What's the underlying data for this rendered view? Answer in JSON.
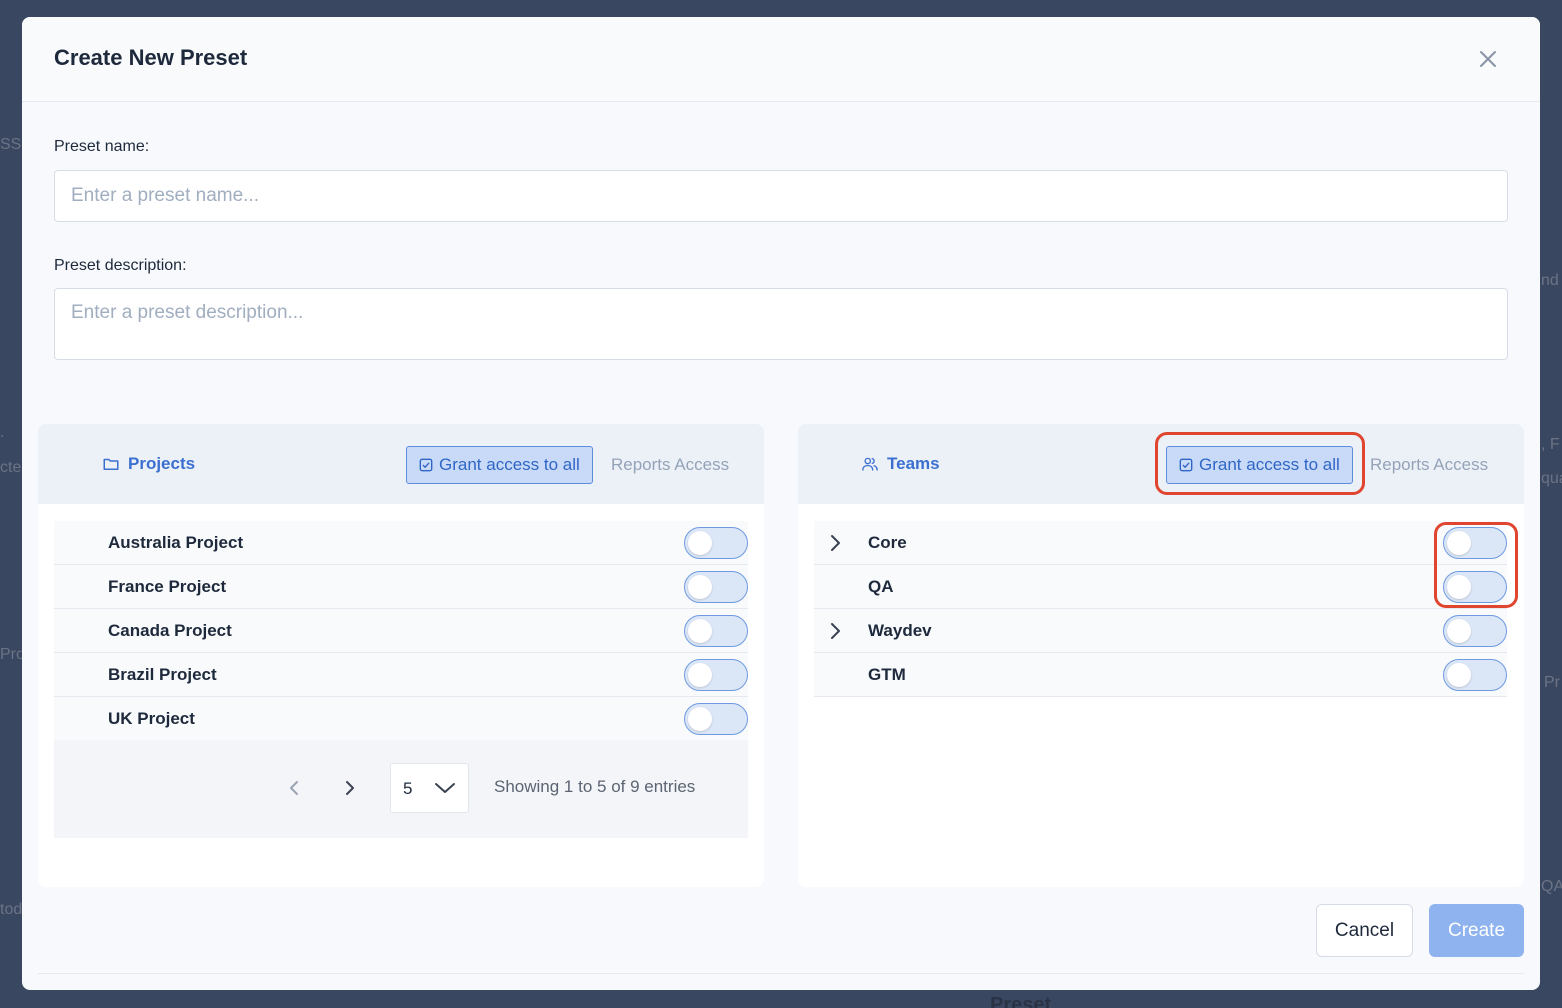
{
  "modal": {
    "title": "Create New Preset",
    "name_label": "Preset name:",
    "name_value": "",
    "name_placeholder": "Enter a preset name...",
    "description_label": "Preset description:",
    "description_value": "",
    "description_placeholder": "Enter a preset description..."
  },
  "projects_panel": {
    "title": "Projects",
    "grant_label": "Grant access to all",
    "reports_label": "Reports Access",
    "rows": [
      {
        "label": "Australia Project",
        "enabled": false
      },
      {
        "label": "France Project",
        "enabled": false
      },
      {
        "label": "Canada Project",
        "enabled": false
      },
      {
        "label": "Brazil Project",
        "enabled": false
      },
      {
        "label": "UK Project",
        "enabled": false
      }
    ],
    "pagination": {
      "page_size": "5",
      "showing_text": "Showing 1 to 5 of 9 entries"
    }
  },
  "teams_panel": {
    "title": "Teams",
    "grant_label": "Grant access to all",
    "reports_label": "Reports Access",
    "rows": [
      {
        "label": "Core",
        "expandable": true,
        "enabled": false
      },
      {
        "label": "QA",
        "expandable": false,
        "enabled": false
      },
      {
        "label": "Waydev",
        "expandable": true,
        "enabled": false
      },
      {
        "label": "GTM",
        "expandable": false,
        "enabled": false
      }
    ]
  },
  "footer": {
    "cancel_label": "Cancel",
    "create_label": "Create"
  },
  "backdrop": {
    "fragments": [
      "SS",
      "nd",
      ".",
      ", F",
      "cte",
      "qua",
      "Pro",
      "Pr",
      "tod",
      "QA",
      "Preset"
    ]
  },
  "colors": {
    "accent": "#3b6fd0",
    "annotation": "#e0452f",
    "create_button": "#8eb3ef"
  },
  "icons": {
    "close": "close-icon",
    "projects": "folder-icon",
    "teams": "users-icon",
    "grant": "checkbox-icon",
    "expand": "chevron-right-icon",
    "prev": "chevron-left-icon",
    "next": "chevron-right-icon",
    "select": "chevron-down-icon"
  }
}
